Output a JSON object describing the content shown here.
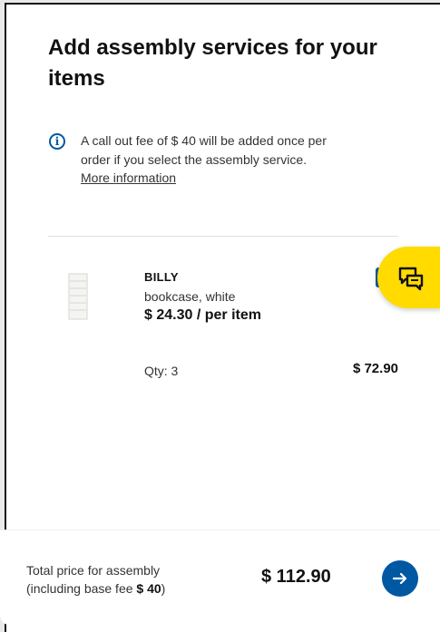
{
  "modal": {
    "title": "Add assembly services for your items",
    "info_text": "A call out fee of $ 40 will be added once per order if you select the assembly service.",
    "more_link": "More information"
  },
  "item": {
    "name": "BILLY",
    "description": "bookcase, white",
    "unit_price": "$ 24.30 / per item",
    "quantity": "Qty: 3",
    "line_total": "$ 72.90",
    "checkbox_checked": true
  },
  "footer": {
    "label_line1": "Total price for assembly",
    "label_line2_prefix": "(including base fee ",
    "base_fee": "$ 40",
    "label_line2_suffix": ")",
    "total": "$ 112.90"
  },
  "icons": {
    "info": "info-icon",
    "chat": "chat-icon",
    "next": "arrow-right-icon"
  },
  "colors": {
    "accent_blue": "#0058a3",
    "chat_yellow": "#ffdb00"
  }
}
